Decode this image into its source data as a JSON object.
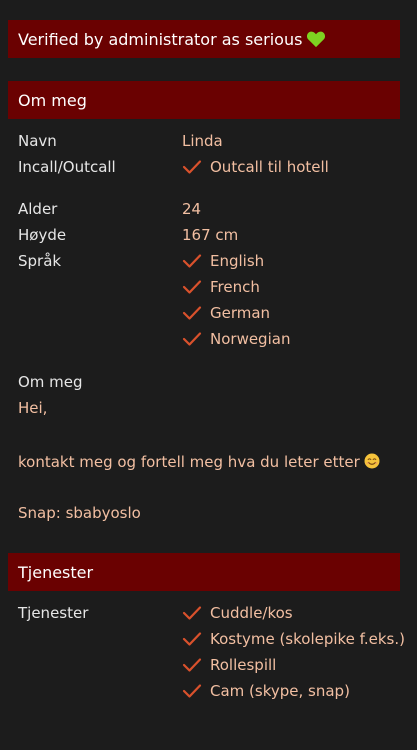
{
  "verified_banner": {
    "text": "Verified by administrator as serious",
    "icon": "green-heart-icon"
  },
  "about_section": {
    "header": "Om meg",
    "rows": {
      "name": {
        "label": "Navn",
        "value": "Linda"
      },
      "incall": {
        "label": "Incall/Outcall",
        "value": "Outcall til hotell"
      },
      "age": {
        "label": "Alder",
        "value": "24"
      },
      "height": {
        "label": "Høyde",
        "value": "167 cm"
      },
      "language": {
        "label": "Språk",
        "values": [
          "English",
          "French",
          "German",
          "Norwegian"
        ]
      }
    },
    "description": {
      "label": "Om meg",
      "greeting": "Hei,",
      "body": "kontakt meg og fortell meg hva du leter etter",
      "snap": "Snap: sbabyoslo"
    }
  },
  "services_section": {
    "header": "Tjenester",
    "label": "Tjenester",
    "items": [
      "Cuddle/kos",
      "Kostyme (skolepike f.eks.)",
      "Rollespill",
      "Cam (skype, snap)"
    ]
  },
  "colors": {
    "banner_bg": "#6a0101",
    "page_bg": "#1c1c1c",
    "value_text": "#f2bfa2",
    "check": "#d9512c"
  }
}
